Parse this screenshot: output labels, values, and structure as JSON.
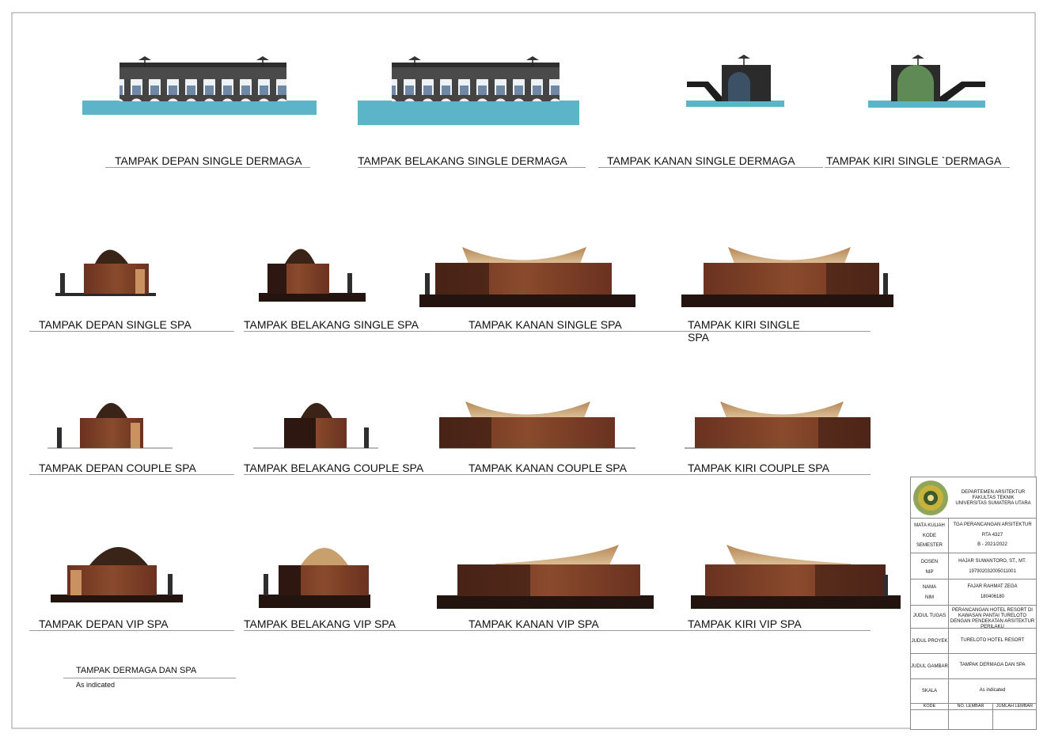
{
  "drawings": [
    {
      "id": "depan-dermaga",
      "label": "TAMPAK DEPAN SINGLE DERMAGA"
    },
    {
      "id": "belakang-dermaga",
      "label": "TAMPAK BELAKANG SINGLE DERMAGA"
    },
    {
      "id": "kanan-dermaga",
      "label": "TAMPAK KANAN SINGLE DERMAGA"
    },
    {
      "id": "kiri-dermaga",
      "label": "TAMPAK KIRI SINGLE `DERMAGA"
    },
    {
      "id": "depan-single-spa",
      "label": "TAMPAK DEPAN SINGLE SPA"
    },
    {
      "id": "belakang-single-spa",
      "label": "TAMPAK BELAKANG SINGLE SPA"
    },
    {
      "id": "kanan-single-spa",
      "label": "TAMPAK KANAN SINGLE SPA"
    },
    {
      "id": "kiri-single-spa",
      "label": "TAMPAK KIRI SINGLE SPA"
    },
    {
      "id": "depan-couple-spa",
      "label": "TAMPAK DEPAN COUPLE SPA"
    },
    {
      "id": "belakang-couple-spa",
      "label": "TAMPAK BELAKANG COUPLE SPA"
    },
    {
      "id": "kanan-couple-spa",
      "label": "TAMPAK KANAN COUPLE SPA"
    },
    {
      "id": "kiri-couple-spa",
      "label": "TAMPAK KIRI COUPLE SPA"
    },
    {
      "id": "depan-vip-spa",
      "label": "TAMPAK DEPAN VIP SPA"
    },
    {
      "id": "belakang-vip-spa",
      "label": "TAMPAK BELAKANG VIP SPA"
    },
    {
      "id": "kanan-vip-spa",
      "label": "TAMPAK KANAN VIP SPA"
    },
    {
      "id": "kiri-vip-spa",
      "label": "TAMPAK KIRI VIP SPA"
    }
  ],
  "sheet": {
    "title": "TAMPAK DERMAGA DAN SPA",
    "scale_note": "As indicated"
  },
  "title_block": {
    "dept": [
      "DEPARTEMEN ARSITEKTUR",
      "FAKULTAS TEKNIK",
      "UNIVERSITAS SUMATERA UTARA"
    ],
    "mata_kuliah_label": "MATA KULIAH",
    "mata_kuliah": "TGA PERANCANGAN ARSITEKTUR",
    "kode_label": "KODE",
    "kode": "RTA 4327",
    "semester_label": "SEMESTER",
    "semester": "B - 2021/2022",
    "dosen_label": "DOSEN",
    "dosen": "HAJAR SUWANTORO, ST., MT.",
    "nip_label": "NIP",
    "nip": "197902032005011001",
    "nama_label": "NAMA",
    "nama": "FAJAR RAHMAT ZEGA",
    "nim_label": "NIM",
    "nim": "180406180",
    "judul_tugas_label": "JUDUL TUGAS",
    "judul_tugas": "PERANCANGAN HOTEL RESORT DI KAWASAN PANTAI TURELOTO DENGAN PENDEKATAN ARSITEKTUR PERILAKU",
    "judul_proyek_label": "JUDUL PROYEK",
    "judul_proyek": "TURELOTO HOTEL RESORT",
    "judul_gambar_label": "JUDUL GAMBAR",
    "judul_gambar": "TAMPAK DERMAGA DAN SPA",
    "skala_label": "SKALA",
    "skala": "As indicated",
    "kode_footer_label": "KODE",
    "no_lembar_label": "NO. LEMBAR",
    "jumlah_lembar_label": "JUMLAH LEMBAR"
  },
  "colors": {
    "water": "#5cb4c8",
    "pier": "#4e4e4e",
    "brick": "#7a3a22",
    "brick_dark": "#3a1d12",
    "roof": "#c9a170",
    "base": "#241410",
    "frame": "#9a9a9a"
  }
}
